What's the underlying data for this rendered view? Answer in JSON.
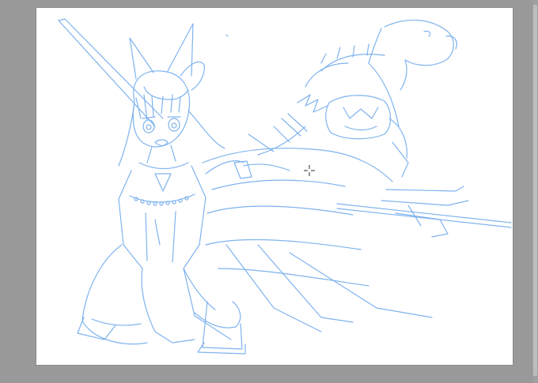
{
  "app": {
    "view": "drawing-canvas",
    "background_color": "#999999",
    "canvas_color": "#ffffff",
    "sketch_color": "#7fb3ee"
  },
  "tool": {
    "cursor_icon": "crosshair-cursor-icon"
  },
  "artwork": {
    "subject": "line-sketch"
  }
}
